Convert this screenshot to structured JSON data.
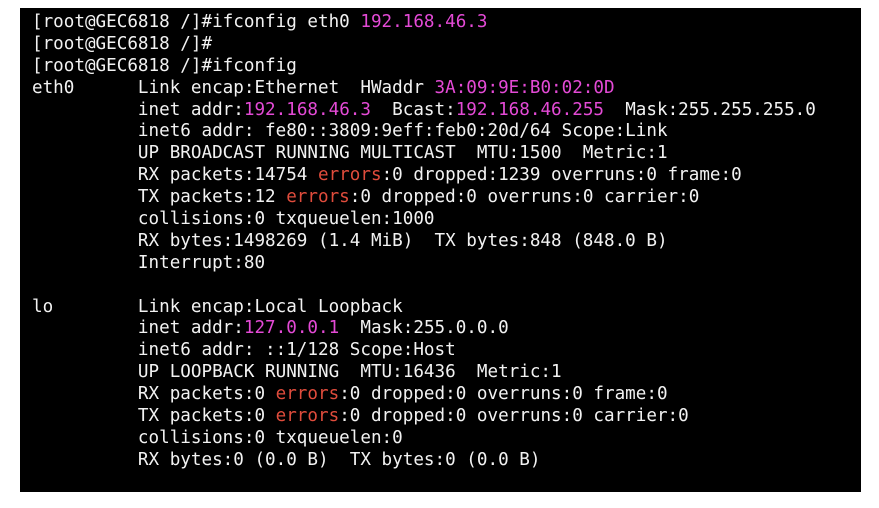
{
  "colors": {
    "background": "#000000",
    "text": "#f2f2f2",
    "ip_magenta": "#e44ad6",
    "error_red": "#e04c3c"
  },
  "lines": [
    {
      "segments": [
        {
          "text": "[root@GEC6818 /]#ifconfig eth0 "
        },
        {
          "text": "192.168.46.3",
          "style": "ip"
        }
      ]
    },
    {
      "segments": [
        {
          "text": "[root@GEC6818 /]#"
        }
      ]
    },
    {
      "segments": [
        {
          "text": "[root@GEC6818 /]#ifconfig"
        }
      ]
    },
    {
      "segments": [
        {
          "text": "eth0      Link encap:Ethernet  HWaddr "
        },
        {
          "text": "3A:09:9E:B0:02:0D",
          "style": "ip"
        }
      ]
    },
    {
      "segments": [
        {
          "text": "          inet addr:"
        },
        {
          "text": "192.168.46.3",
          "style": "ip"
        },
        {
          "text": "  Bcast:"
        },
        {
          "text": "192.168.46.255",
          "style": "ip"
        },
        {
          "text": "  Mask:255.255.255.0"
        }
      ]
    },
    {
      "segments": [
        {
          "text": "          inet6 addr: fe80::3809:9eff:feb0:20d/64 Scope:Link"
        }
      ]
    },
    {
      "segments": [
        {
          "text": "          UP BROADCAST RUNNING MULTICAST  MTU:1500  Metric:1"
        }
      ]
    },
    {
      "segments": [
        {
          "text": "          RX packets:14754 "
        },
        {
          "text": "errors",
          "style": "err"
        },
        {
          "text": ":0 dropped:1239 overruns:0 frame:0"
        }
      ]
    },
    {
      "segments": [
        {
          "text": "          TX packets:12 "
        },
        {
          "text": "errors",
          "style": "err"
        },
        {
          "text": ":0 dropped:0 overruns:0 carrier:0"
        }
      ]
    },
    {
      "segments": [
        {
          "text": "          collisions:0 txqueuelen:1000"
        }
      ]
    },
    {
      "segments": [
        {
          "text": "          RX bytes:1498269 (1.4 MiB)  TX bytes:848 (848.0 B)"
        }
      ]
    },
    {
      "segments": [
        {
          "text": "          Interrupt:80"
        }
      ]
    },
    {
      "segments": [
        {
          "text": ""
        }
      ]
    },
    {
      "segments": [
        {
          "text": "lo        Link encap:Local Loopback"
        }
      ]
    },
    {
      "segments": [
        {
          "text": "          inet addr:"
        },
        {
          "text": "127.0.0.1",
          "style": "ip"
        },
        {
          "text": "  Mask:255.0.0.0"
        }
      ]
    },
    {
      "segments": [
        {
          "text": "          inet6 addr: ::1/128 Scope:Host"
        }
      ]
    },
    {
      "segments": [
        {
          "text": "          UP LOOPBACK RUNNING  MTU:16436  Metric:1"
        }
      ]
    },
    {
      "segments": [
        {
          "text": "          RX packets:0 "
        },
        {
          "text": "errors",
          "style": "err"
        },
        {
          "text": ":0 dropped:0 overruns:0 frame:0"
        }
      ]
    },
    {
      "segments": [
        {
          "text": "          TX packets:0 "
        },
        {
          "text": "errors",
          "style": "err"
        },
        {
          "text": ":0 dropped:0 overruns:0 carrier:0"
        }
      ]
    },
    {
      "segments": [
        {
          "text": "          collisions:0 txqueuelen:0"
        }
      ]
    },
    {
      "segments": [
        {
          "text": "          RX bytes:0 (0.0 B)  TX bytes:0 (0.0 B)"
        }
      ]
    }
  ]
}
